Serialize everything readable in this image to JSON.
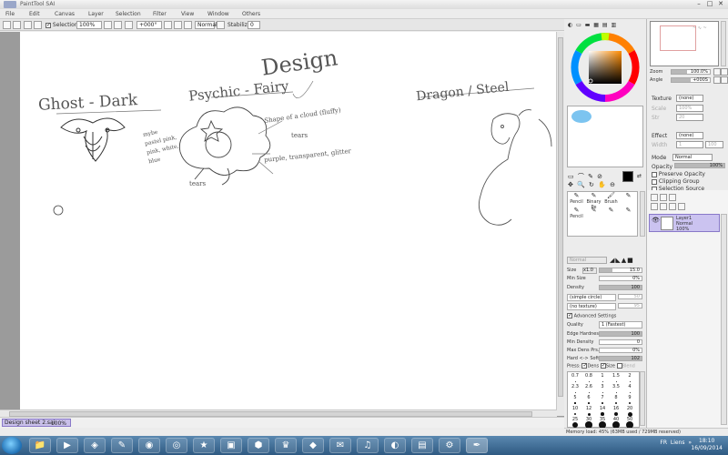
{
  "window": {
    "title": "PaintTool SAI"
  },
  "menu": [
    "File",
    "Edit",
    "Canvas",
    "Layer",
    "Selection",
    "Filter",
    "View",
    "Window",
    "Others"
  ],
  "toolbar": {
    "selection_label": "Selection",
    "zoom_value": "100%",
    "angle_value": "+000°",
    "mode_value": "Normal",
    "stabilizer_label": "Stabilizer",
    "stabilizer_value": "0"
  },
  "canvas_text": {
    "design": "Design",
    "ghost_dark": "Ghost - Dark",
    "psychic_fairy": "Psychic - Fairy",
    "dragon_steel": "Dragon / Steel",
    "note_cloud": "Shape of a cloud (fluffy)",
    "note_tears": "tears",
    "note_purple": "purple, transparent, glitter",
    "note_tears2": "tears",
    "note_left": "mybe pastel pink, pink, white, blue"
  },
  "navigator": {
    "zoom_label": "Zoom",
    "zoom_value": "100.0%",
    "angle_label": "Angle",
    "angle_value": "+000S"
  },
  "layer_props": {
    "texture_label": "Texture",
    "texture_value": "(none)",
    "scale_label": "Scale",
    "scale_value": "100%",
    "strength_label": "Str",
    "strength_value": "20",
    "effect_label": "Effect",
    "effect_value": "(none)",
    "width_label": "Width",
    "width_value": "1",
    "effect_strength_value": "100",
    "mode_label": "Mode",
    "mode_value": "Normal",
    "opacity_label": "Opacity",
    "opacity_value": "100%",
    "preserve_opacity": "Preserve Opacity",
    "clipping_group": "Clipping Group",
    "selection_source": "Selection Source"
  },
  "layers": [
    {
      "name": "Layer1",
      "mode": "Normal",
      "opacity": "100%"
    }
  ],
  "tools": {
    "cells": [
      "Pencil",
      "Binary Pe",
      "Brush",
      "",
      "Pencil",
      "",
      "",
      ""
    ],
    "brush_mode": "Normal",
    "size_label": "Size",
    "size_mult": "x1.0",
    "size_value": "15.0",
    "min_size_label": "Min Size",
    "min_size_value": "0%",
    "density_label": "Density",
    "density_value": "100",
    "shape_value": "(simple circle)",
    "shape_num": "50",
    "texture_value": "(no texture)",
    "texture_num": "95",
    "advanced_label": "Advanced Settings",
    "quality_label": "Quality",
    "quality_value": "1 (Fastest)",
    "edge_hardness_label": "Edge Hardness",
    "edge_hardness_value": "100",
    "min_density_label": "Min Density",
    "min_density_value": "0",
    "max_dens_label": "Max Dens Prs.",
    "max_dens_value": "0%",
    "hard_soft_label": "Hard <-> Soft",
    "hard_soft_value": "102",
    "press_label": "Press:",
    "dens_label": "Dens",
    "size_chk_label": "Size",
    "blend_label": "Blend"
  },
  "brush_sizes": [
    "0.7",
    "0.8",
    "1",
    "1.5",
    "2",
    "2.3",
    "2.6",
    "3",
    "3.5",
    "4",
    "5",
    "6",
    "7",
    "8",
    "9",
    "10",
    "12",
    "14",
    "16",
    "20",
    "25",
    "30",
    "35",
    "40",
    "50"
  ],
  "document": {
    "tab_name": "Design sheet 2.sai",
    "zoom": "100%"
  },
  "status": {
    "memory": "Memory load: 45% (63MB used / 729MB reserved)"
  },
  "taskbar": {
    "lang": "FR",
    "links": "Liens",
    "time": "18:10",
    "date": "16/09/2014"
  },
  "colors": {
    "accent": "#8878c8",
    "selection_bg": "#cbc3f0",
    "taskbar": "#3b6a95"
  }
}
